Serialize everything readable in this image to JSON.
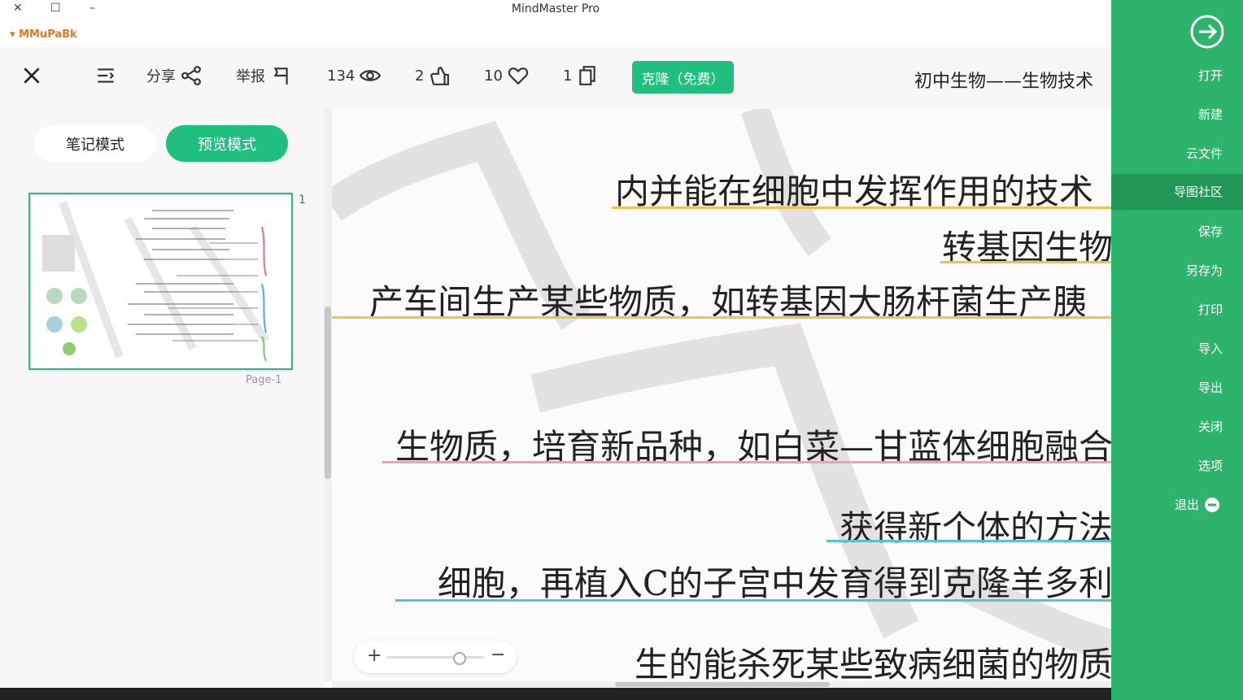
{
  "window": {
    "title": "MindMaster Pro",
    "brand": "MMuPaBk",
    "close_glyph": "✕",
    "restore_glyph": "☐",
    "minimize_glyph": "–"
  },
  "toolbar": {
    "doc_title": "初中生物——生物技术",
    "clone_label": "克隆（免费）",
    "pages_count": "1",
    "likes_count": "10",
    "thumbs_count": "2",
    "views_count": "134",
    "report_label": "举报",
    "share_label": "分享"
  },
  "left_panel": {
    "preview_mode_label": "预览模式",
    "note_mode_label": "笔记模式",
    "page_number": "1",
    "page_label": "Page-1"
  },
  "canvas": {
    "nodes": [
      {
        "text": "内并能在细胞中发挥作用的技术",
        "color": "#f2c14e"
      },
      {
        "text": "转基因生物",
        "color": "#f2c14e"
      },
      {
        "text": "产车间生产某些物质，如转基因大肠杆菌生产胰",
        "color": "#f2c14e"
      },
      {
        "text": "生物质，培育新品种，如白菜—甘蓝体细胞融合",
        "color": "#f29ac8"
      },
      {
        "text": "获得新个体的方法",
        "color": "#5bc0d0"
      },
      {
        "text": "细胞，再植入C的子宫中发育得到克隆羊多利",
        "color": "#5bc0d0"
      },
      {
        "text": "生的能杀死某些致病细菌的物质",
        "color": "#5bc0d0"
      }
    ]
  },
  "zoom": {
    "plus": "+",
    "minus": "−",
    "level": 0.75
  },
  "sidebar": {
    "items": [
      {
        "label": "打开"
      },
      {
        "label": "新建"
      },
      {
        "label": "云文件"
      },
      {
        "label": "导图社区"
      },
      {
        "label": "保存"
      },
      {
        "label": "另存为"
      },
      {
        "label": "打印"
      },
      {
        "label": "导入"
      },
      {
        "label": "导出"
      },
      {
        "label": "关闭"
      },
      {
        "label": "选项"
      }
    ],
    "exit_label": "退出"
  },
  "colors": {
    "accent": "#1fbf7f",
    "sidebar": "#2db36c",
    "sidebar_active": "#229657"
  }
}
